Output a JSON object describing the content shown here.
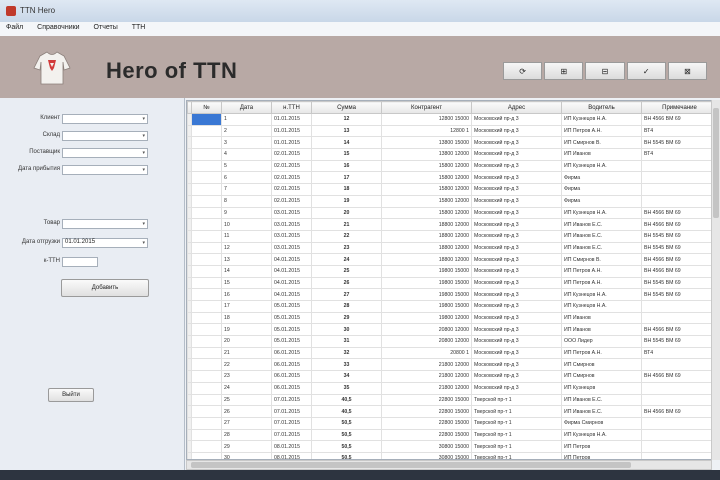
{
  "window": {
    "title": "TTN Hero"
  },
  "menu": [
    "Файл",
    "Справочники",
    "Отчеты",
    "ТТН"
  ],
  "banner": {
    "brand": "Hero of TTN"
  },
  "toolbar": [
    "⟳",
    "⊞",
    "⊟",
    "✓",
    "⊠"
  ],
  "filters": {
    "items": [
      {
        "label": "Клиент",
        "value": ""
      },
      {
        "label": "Склад",
        "value": ""
      },
      {
        "label": "Поставщик",
        "value": ""
      },
      {
        "label": "Дата прибытия",
        "value": ""
      },
      {
        "label": "Товар",
        "value": ""
      },
      {
        "label": "Дата отгрузки",
        "value": "01.01.2015"
      },
      {
        "label": "к-ТТН",
        "value": ""
      }
    ],
    "add_button": "Добавить",
    "bottom_button": "Выйти"
  },
  "grid": {
    "columns": [
      "№",
      "Дата",
      "н.ТТН",
      "Сумма",
      "Контрагент",
      "Адрес",
      "Водитель",
      "Примечание"
    ],
    "rows": [
      [
        "1",
        "01.01.2015",
        "12",
        "12800 15000",
        "Московский пр-д 3",
        "ИП Кузнецов Н.А.",
        "ВН 4566 ВМ 69"
      ],
      [
        "2",
        "01.01.2015",
        "13",
        "12800 1",
        "Московский пр-д 3",
        "ИП Петров А.Н.",
        "ВТ4"
      ],
      [
        "3",
        "01.01.2015",
        "14",
        "13800 15000",
        "Московский пр-д 3",
        "ИП Смирнов В.",
        "ВН 5545 ВМ 69"
      ],
      [
        "4",
        "02.01.2015",
        "15",
        "13800 12000",
        "Московский пр-д 3",
        "ИП Иванов",
        "ВТ4"
      ],
      [
        "5",
        "02.01.2015",
        "16",
        "15800 12000",
        "Московский пр-д 3",
        "ИП Кузнецов Н.А.",
        ""
      ],
      [
        "6",
        "02.01.2015",
        "17",
        "15800 12000",
        "Московский пр-д 3",
        "Фирма",
        ""
      ],
      [
        "7",
        "02.01.2015",
        "18",
        "15800 12000",
        "Московский пр-д 3",
        "Фирма",
        ""
      ],
      [
        "8",
        "02.01.2015",
        "19",
        "15800 12000",
        "Московский пр-д 3",
        "Фирма",
        ""
      ],
      [
        "9",
        "03.01.2015",
        "20",
        "15800 12000",
        "Московский пр-д 3",
        "ИП Кузнецов Н.А.",
        "ВН 4566 ВМ 69"
      ],
      [
        "10",
        "03.01.2015",
        "21",
        "18800 12000",
        "Московский пр-д 3",
        "ИП Иванов Е.С.",
        "ВН 4566 ВМ 69"
      ],
      [
        "11",
        "03.01.2015",
        "22",
        "18800 12000",
        "Московский пр-д 3",
        "ИП Иванов Е.С.",
        "ВН 5545 ВМ 69"
      ],
      [
        "12",
        "03.01.2015",
        "23",
        "18800 12000",
        "Московский пр-д 3",
        "ИП Иванов Е.С.",
        "ВН 5545 ВМ 69"
      ],
      [
        "13",
        "04.01.2015",
        "24",
        "18800 12000",
        "Московский пр-д 3",
        "ИП Смирнов В.",
        "ВН 4566 ВМ 69"
      ],
      [
        "14",
        "04.01.2015",
        "25",
        "19800 15000",
        "Московский пр-д 3",
        "ИП Петров А.Н.",
        "ВН 4566 ВМ 69"
      ],
      [
        "15",
        "04.01.2015",
        "26",
        "19800 15000",
        "Московский пр-д 3",
        "ИП Петров А.Н.",
        "ВН 5545 ВМ 69"
      ],
      [
        "16",
        "04.01.2015",
        "27",
        "19800 15000",
        "Московский пр-д 3",
        "ИП Кузнецов Н.А.",
        "ВН 5545 ВМ 69"
      ],
      [
        "17",
        "05.01.2015",
        "28",
        "19800 15000",
        "Московский пр-д 3",
        "ИП Кузнецов Н.А.",
        ""
      ],
      [
        "18",
        "05.01.2015",
        "29",
        "19800 12000",
        "Московский пр-д 3",
        "ИП Иванов",
        ""
      ],
      [
        "19",
        "05.01.2015",
        "30",
        "20800 12000",
        "Московский пр-д 3",
        "ИП Иванов",
        "ВН 4566 ВМ 69"
      ],
      [
        "20",
        "05.01.2015",
        "31",
        "20800 12000",
        "Московский пр-д 3",
        "ООО Лидер",
        "ВН 5545 ВМ 69"
      ],
      [
        "21",
        "06.01.2015",
        "32",
        "20800 1",
        "Московский пр-д 3",
        "ИП Петров А.Н.",
        "ВТ4"
      ],
      [
        "22",
        "06.01.2015",
        "33",
        "21800 12000",
        "Московский пр-д 3",
        "ИП Смирнов",
        ""
      ],
      [
        "23",
        "06.01.2015",
        "34",
        "21800 12000",
        "Московский пр-д 3",
        "ИП Смирнов",
        "ВН 4566 ВМ 69"
      ],
      [
        "24",
        "06.01.2015",
        "35",
        "21800 12000",
        "Московский пр-д 3",
        "ИП Кузнецов",
        ""
      ],
      [
        "25",
        "07.01.2015",
        "40,5",
        "22800 15000",
        "Тверской пр-т 1",
        "ИП Иванов Е.С.",
        ""
      ],
      [
        "26",
        "07.01.2015",
        "40,5",
        "22800 15000",
        "Тверской пр-т 1",
        "ИП Иванов Е.С.",
        "ВН 4566 ВМ 69"
      ],
      [
        "27",
        "07.01.2015",
        "50,5",
        "22800 15000",
        "Тверской пр-т 1",
        "Фирма Смирнов",
        ""
      ],
      [
        "28",
        "07.01.2015",
        "50,5",
        "22800 15000",
        "Тверской пр-т 1",
        "ИП Кузнецов Н.А.",
        ""
      ],
      [
        "29",
        "08.01.2015",
        "50,5",
        "30800 15000",
        "Тверской пр-т 1",
        "ИП Петров",
        ""
      ],
      [
        "30",
        "08.01.2015",
        "50,5",
        "30800 15000",
        "Тверской пр-т 1",
        "ИП Петров",
        ""
      ],
      [
        "31",
        "08.01.2015",
        "50,5",
        "30800 15000",
        "Тверской пр-т 1",
        "ИП Смирнов",
        ""
      ]
    ]
  }
}
